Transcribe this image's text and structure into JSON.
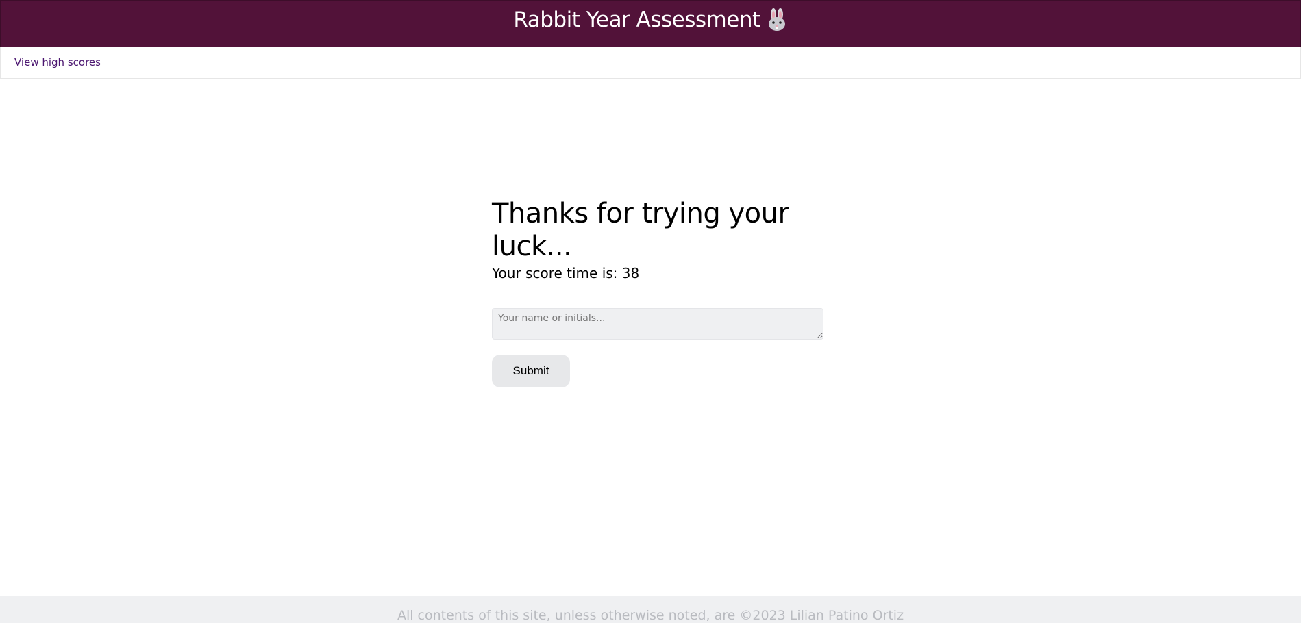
{
  "header": {
    "title": "Rabbit Year Assessment",
    "icon": "rabbit-icon",
    "background_color": "#521239"
  },
  "nav": {
    "high_scores_link": "View high scores",
    "link_color": "#4b1670"
  },
  "main": {
    "heading": "Thanks for trying your luck...",
    "score_label": "Your score time is:",
    "score_value": "38",
    "name_input": {
      "placeholder": "Your name or initials...",
      "value": ""
    },
    "submit_label": "Submit"
  },
  "footer": {
    "text": "All contents of this site, unless otherwise noted, are ©2023 Lilian Patino Ortiz"
  }
}
